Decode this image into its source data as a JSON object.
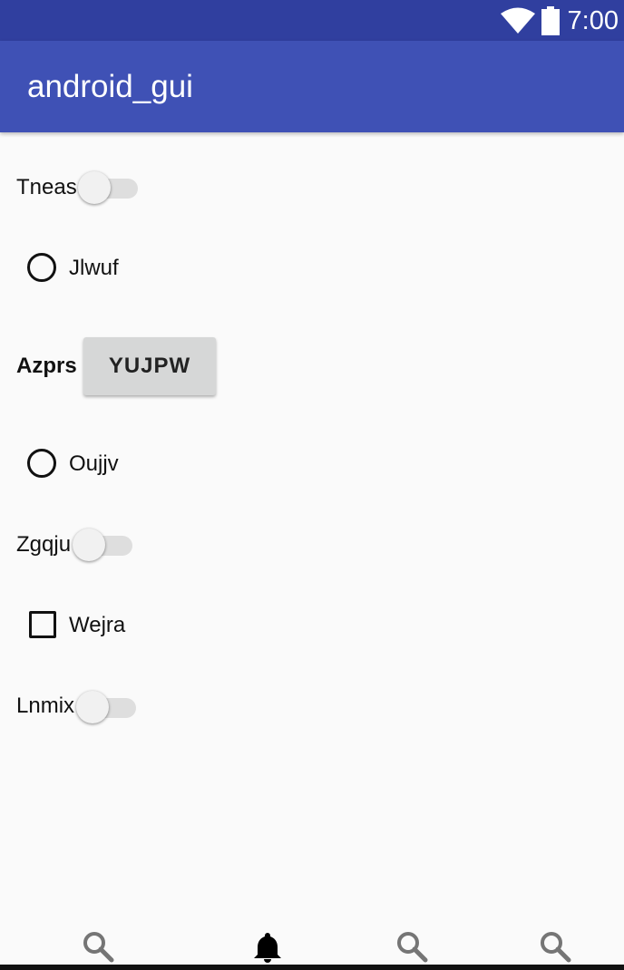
{
  "status_bar": {
    "time": "7:00"
  },
  "app_bar": {
    "title": "android_gui"
  },
  "content": {
    "switch_1": {
      "label": "Tneas",
      "checked": false
    },
    "radio_1": {
      "label": "Jlwuf",
      "checked": false
    },
    "button_row": {
      "label": "Azprs",
      "button": "YUJPW"
    },
    "radio_2": {
      "label": "Oujjv",
      "checked": false
    },
    "switch_2": {
      "label": "Zgqju",
      "checked": false
    },
    "checkbox_1": {
      "label": "Wejra",
      "checked": false
    },
    "switch_3": {
      "label": "Lnmix",
      "checked": false
    }
  },
  "bottom_nav": {
    "items": [
      {
        "icon": "search-icon"
      },
      {
        "icon": "bell-icon"
      },
      {
        "icon": "search-icon"
      },
      {
        "icon": "search-icon"
      }
    ]
  },
  "colors": {
    "status_bar": "#303f9f",
    "app_bar": "#3f51b5",
    "background": "#fafafa"
  }
}
